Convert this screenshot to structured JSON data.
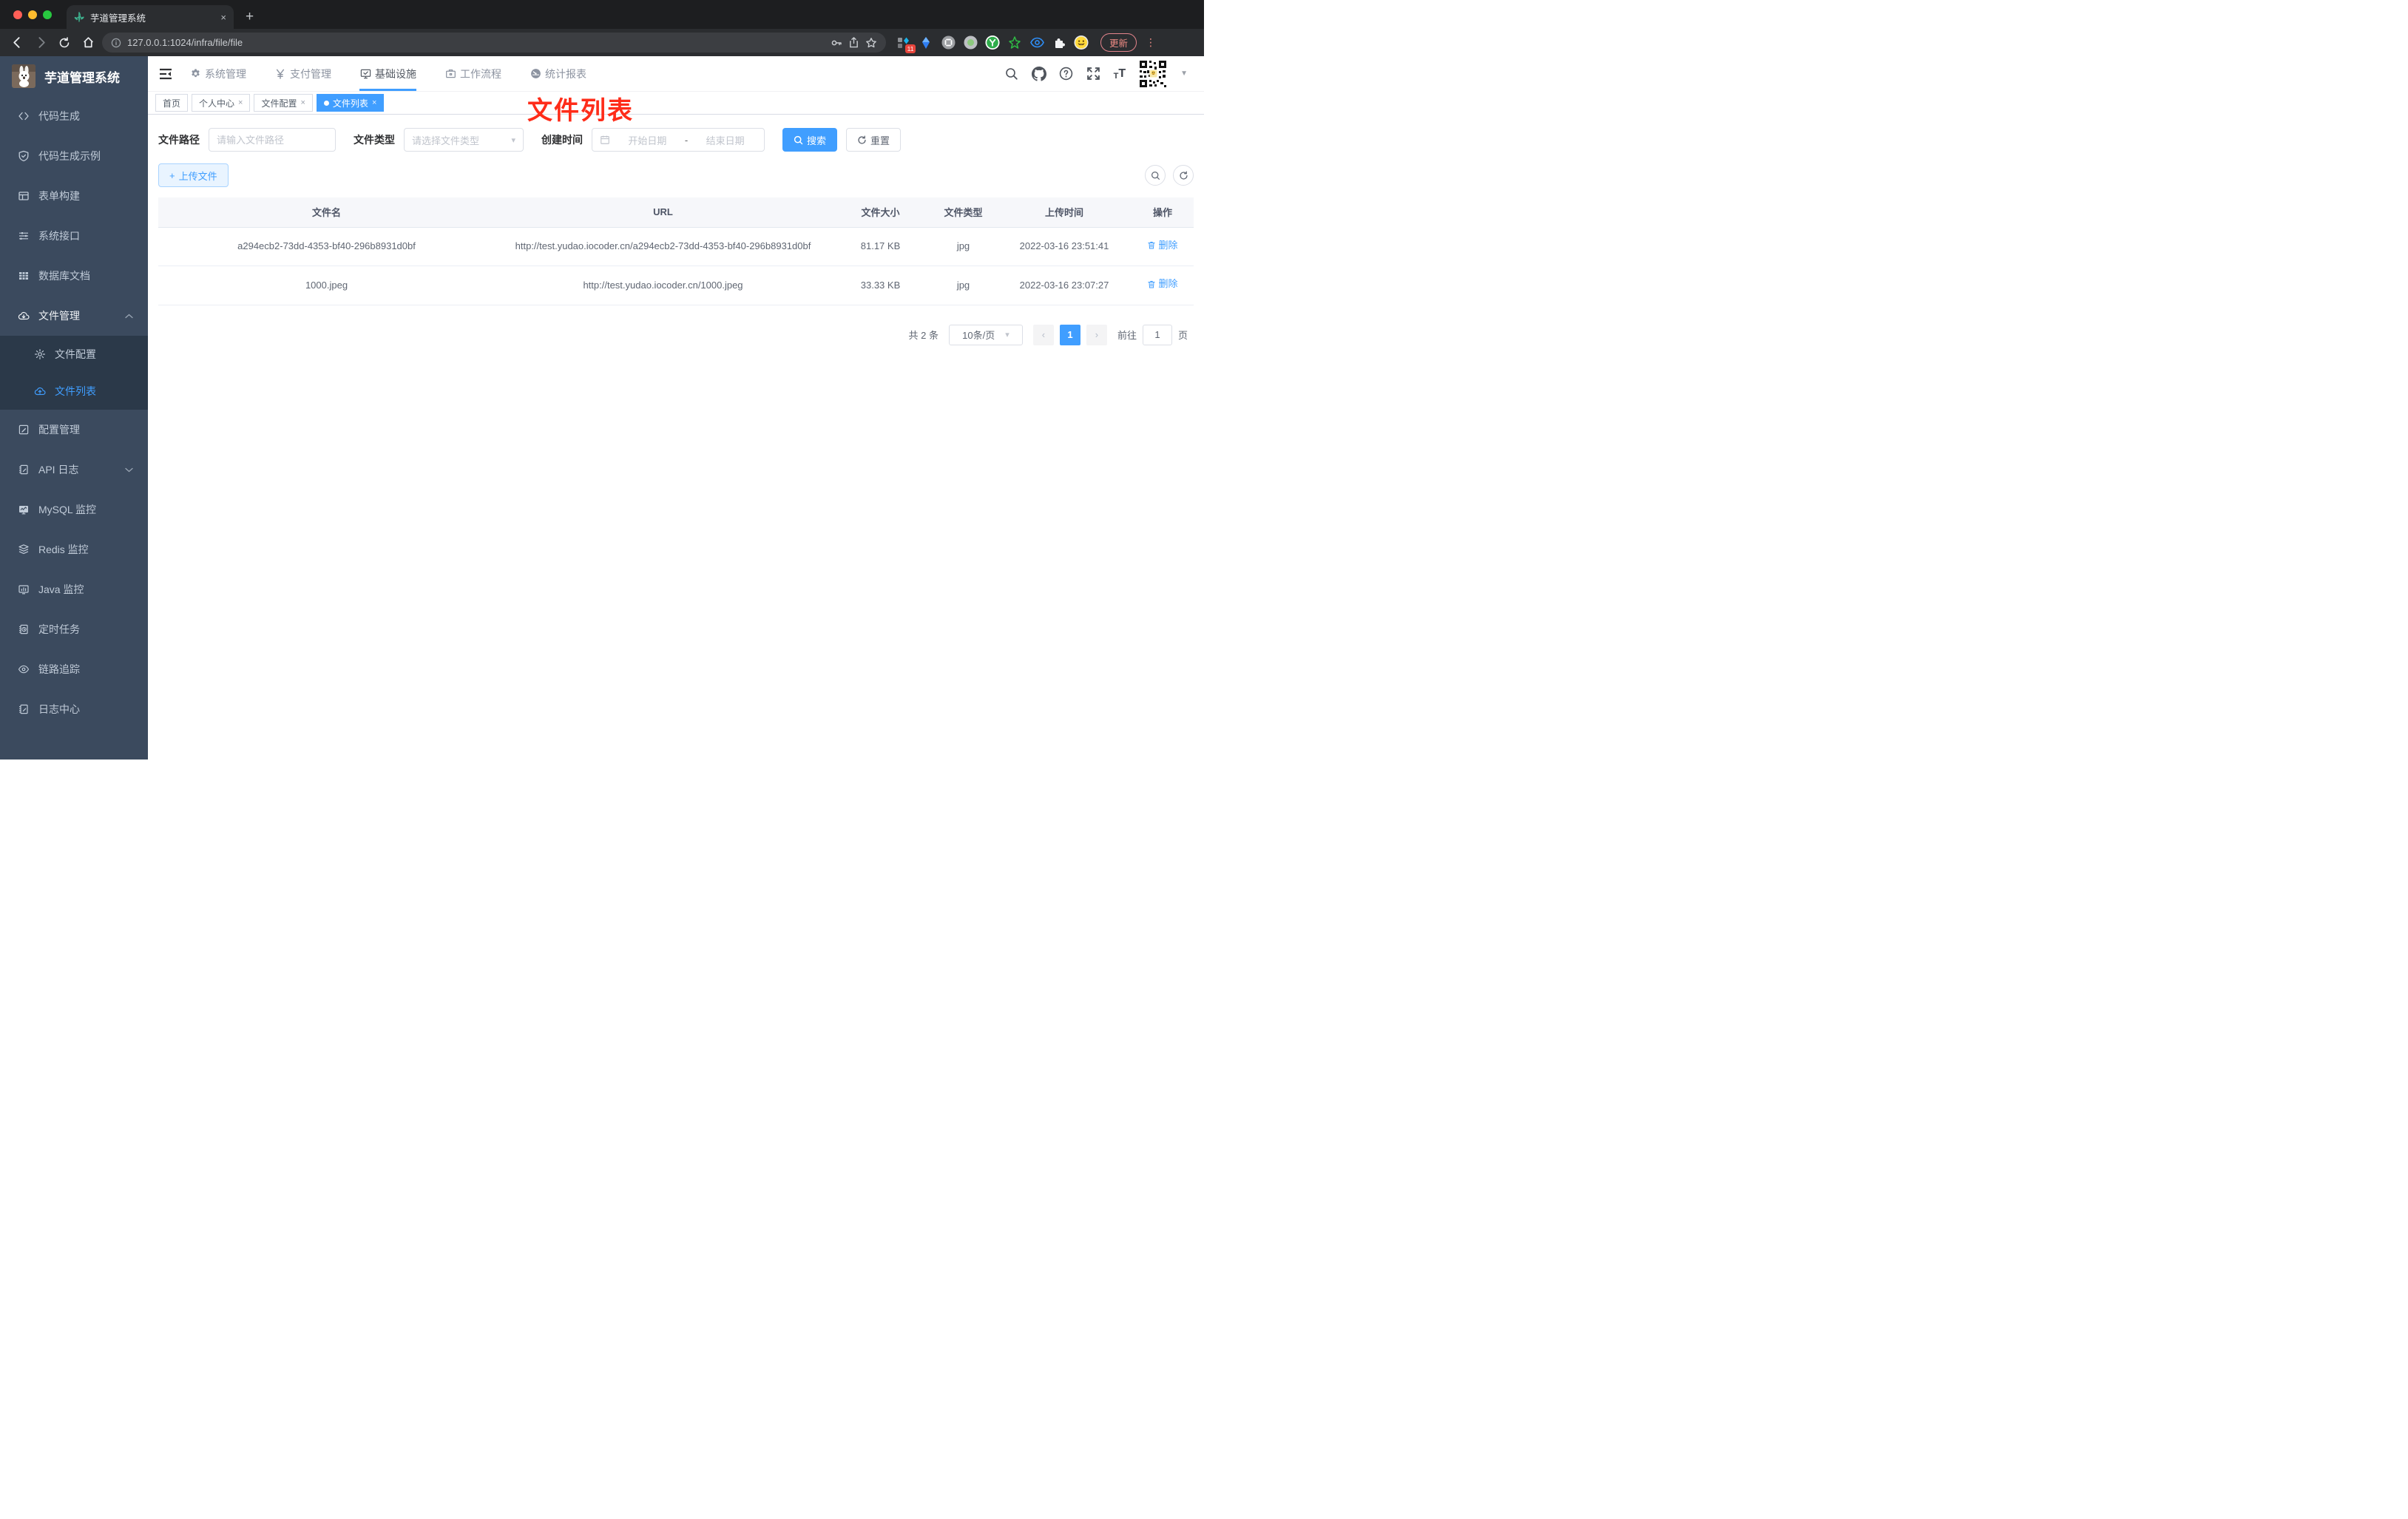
{
  "browser": {
    "tab_title": "芋道管理系统",
    "close_tab": "×",
    "new_tab": "+",
    "url": "127.0.0.1:1024/infra/file/file",
    "extension_badge": "11",
    "update_label": "更新",
    "menu_dots": "⋮"
  },
  "app": {
    "title": "芋道管理系统"
  },
  "sidebar": {
    "items": [
      {
        "label": "代码生成"
      },
      {
        "label": "代码生成示例"
      },
      {
        "label": "表单构建"
      },
      {
        "label": "系统接口"
      },
      {
        "label": "数据库文档"
      },
      {
        "label": "文件管理"
      },
      {
        "label": "文件配置"
      },
      {
        "label": "文件列表"
      },
      {
        "label": "配置管理"
      },
      {
        "label": "API 日志"
      },
      {
        "label": "MySQL 监控"
      },
      {
        "label": "Redis 监控"
      },
      {
        "label": "Java 监控"
      },
      {
        "label": "定时任务"
      },
      {
        "label": "链路追踪"
      },
      {
        "label": "日志中心"
      }
    ]
  },
  "topnav": {
    "items": [
      {
        "label": "系统管理"
      },
      {
        "label": "支付管理"
      },
      {
        "label": "基础设施"
      },
      {
        "label": "工作流程"
      },
      {
        "label": "统计报表"
      }
    ]
  },
  "tags": [
    {
      "label": "首页"
    },
    {
      "label": "个人中心"
    },
    {
      "label": "文件配置"
    },
    {
      "label": "文件列表"
    }
  ],
  "annotation": {
    "text": "文件列表"
  },
  "filters": {
    "path_label": "文件路径",
    "path_placeholder": "请输入文件路径",
    "type_label": "文件类型",
    "type_placeholder": "请选择文件类型",
    "date_label": "创建时间",
    "date_start_placeholder": "开始日期",
    "date_separator": "-",
    "date_end_placeholder": "结束日期",
    "search_label": "搜索",
    "reset_label": "重置"
  },
  "toolbar": {
    "upload_label": "上传文件",
    "upload_plus": "+"
  },
  "table": {
    "headers": [
      "文件名",
      "URL",
      "文件大小",
      "文件类型",
      "上传时间",
      "操作"
    ],
    "rows": [
      {
        "name": "a294ecb2-73dd-4353-bf40-296b8931d0bf",
        "url": "http://test.yudao.iocoder.cn/a294ecb2-73dd-4353-bf40-296b8931d0bf",
        "size": "81.17 KB",
        "type": "jpg",
        "time": "2022-03-16 23:51:41",
        "action": "删除"
      },
      {
        "name": "1000.jpeg",
        "url": "http://test.yudao.iocoder.cn/1000.jpeg",
        "size": "33.33 KB",
        "type": "jpg",
        "time": "2022-03-16 23:07:27",
        "action": "删除"
      }
    ]
  },
  "pagination": {
    "total_text": "共 2 条",
    "page_size": "10条/页",
    "prev": "‹",
    "next": "›",
    "current_page": "1",
    "goto_label": "前往",
    "goto_value": "1",
    "goto_suffix": "页"
  },
  "colors": {
    "accent": "#409eff",
    "annotation_red": "#fe2c19",
    "sidebar_bg": "#3b4a5e"
  }
}
